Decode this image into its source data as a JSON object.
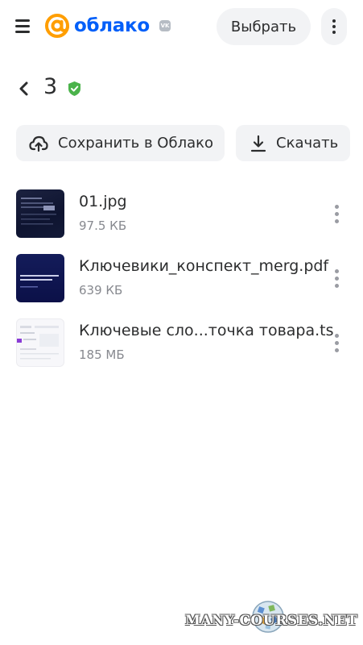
{
  "header": {
    "logo_text": "облако",
    "vk_badge": "VK",
    "select_label": "Выбрать",
    "icons": {
      "menu": "hamburger-icon",
      "logo": "at-sign-icon",
      "more": "vertical-dots-icon"
    }
  },
  "folder": {
    "title": "3",
    "icons": {
      "back": "chevron-left-icon",
      "status": "shield-check-icon"
    },
    "status_color": "#4bb34b"
  },
  "actions": {
    "save_label": "Сохранить в Облако",
    "download_label": "Скачать",
    "icons": {
      "save": "cloud-upload-icon",
      "download": "download-icon"
    }
  },
  "files": [
    {
      "name": "01.jpg",
      "size": "97.5 КБ",
      "type": "image"
    },
    {
      "name": "Ключевики_конспект_merg.pdf",
      "size": "639 КБ",
      "type": "pdf"
    },
    {
      "name": "Ключевые сло...точка товара.ts",
      "size": "185 МБ",
      "type": "video"
    }
  ],
  "watermark": {
    "text": "MANY-COURSES.NET"
  },
  "colors": {
    "brand_orange": "#ff9e00",
    "brand_blue": "#005ff9",
    "button_bg": "#f2f3f5",
    "text_secondary": "#87898f"
  }
}
